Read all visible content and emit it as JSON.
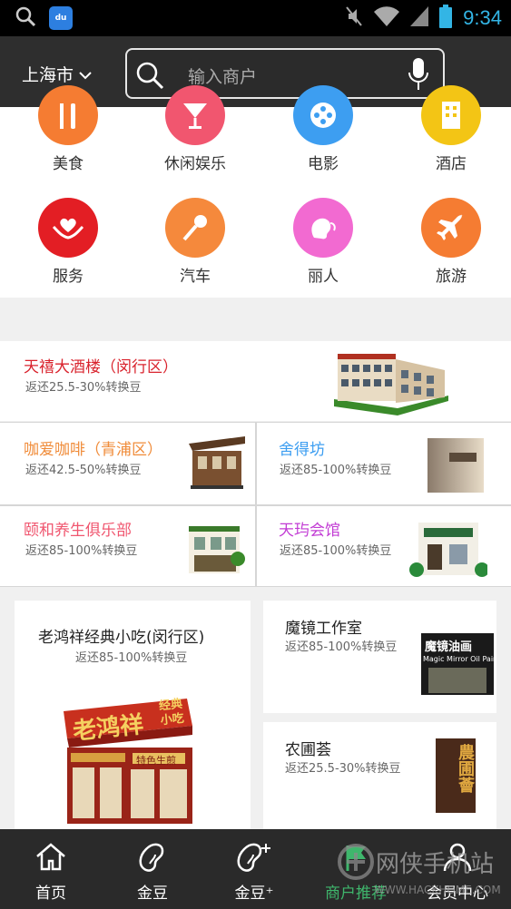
{
  "status_bar": {
    "time": "9:34"
  },
  "header": {
    "city": "上海市",
    "search_placeholder": "输入商户"
  },
  "categories": [
    {
      "label": "美食",
      "color": "#f57c32",
      "icon": "fork-knife-icon"
    },
    {
      "label": "休闲娱乐",
      "color": "#f1566f",
      "icon": "cocktail-icon"
    },
    {
      "label": "电影",
      "color": "#3d9ef1",
      "icon": "film-reel-icon"
    },
    {
      "label": "酒店",
      "color": "#f3c515",
      "icon": "building-icon"
    },
    {
      "label": "服务",
      "color": "#e31e24",
      "icon": "heart-hands-icon"
    },
    {
      "label": "汽车",
      "color": "#f5893c",
      "icon": "microphone-icon"
    },
    {
      "label": "丽人",
      "color": "#f26ad1",
      "icon": "woman-face-icon"
    },
    {
      "label": "旅游",
      "color": "#f57c32",
      "icon": "airplane-icon"
    }
  ],
  "merchants": {
    "featured": {
      "name": "天禧大酒楼（闵行区）",
      "rebate": "返还25.5-30%转换豆",
      "color": "#d9232d"
    },
    "grid": [
      {
        "name": "咖爱咖啡（青浦区）",
        "rebate": "返还42.5-50%转换豆",
        "color": "#f08c3a"
      },
      {
        "name": "舍得坊",
        "rebate": "返还85-100%转换豆",
        "color": "#3d9ef1"
      },
      {
        "name": "颐和养生俱乐部",
        "rebate": "返还85-100%转换豆",
        "color": "#f0566f"
      },
      {
        "name": "天玙会馆",
        "rebate": "返还85-100%转换豆",
        "color": "#c23bd4"
      }
    ],
    "big_card": {
      "name": "老鸿祥经典小吃(闵行区)",
      "rebate": "返还85-100%转换豆",
      "sign_main": "老鸿祥",
      "sign_side": "经典\n小吃",
      "sign_sub": "特色生煎"
    },
    "side_cards": [
      {
        "name": "魔镜工作室",
        "rebate": "返还85-100%转换豆",
        "sign": "魔镜油画",
        "sign_en": "Magic Mirror Oil Painting"
      },
      {
        "name": "农圃荟",
        "rebate": "返还25.5-30%转换豆",
        "sign": "農圃薈"
      }
    ]
  },
  "bottom_nav": [
    {
      "label": "首页",
      "icon": "home-icon",
      "active": false
    },
    {
      "label": "金豆",
      "icon": "bean-icon",
      "active": false
    },
    {
      "label": "金豆⁺",
      "icon": "bean-plus-icon",
      "active": false
    },
    {
      "label": "商户推荐",
      "icon": "flag-icon",
      "active": true
    },
    {
      "label": "会员中心",
      "icon": "person-icon",
      "active": false
    }
  ],
  "watermark": {
    "text": "网侠手机站",
    "url": "WWW.HACKHOME.COM"
  }
}
